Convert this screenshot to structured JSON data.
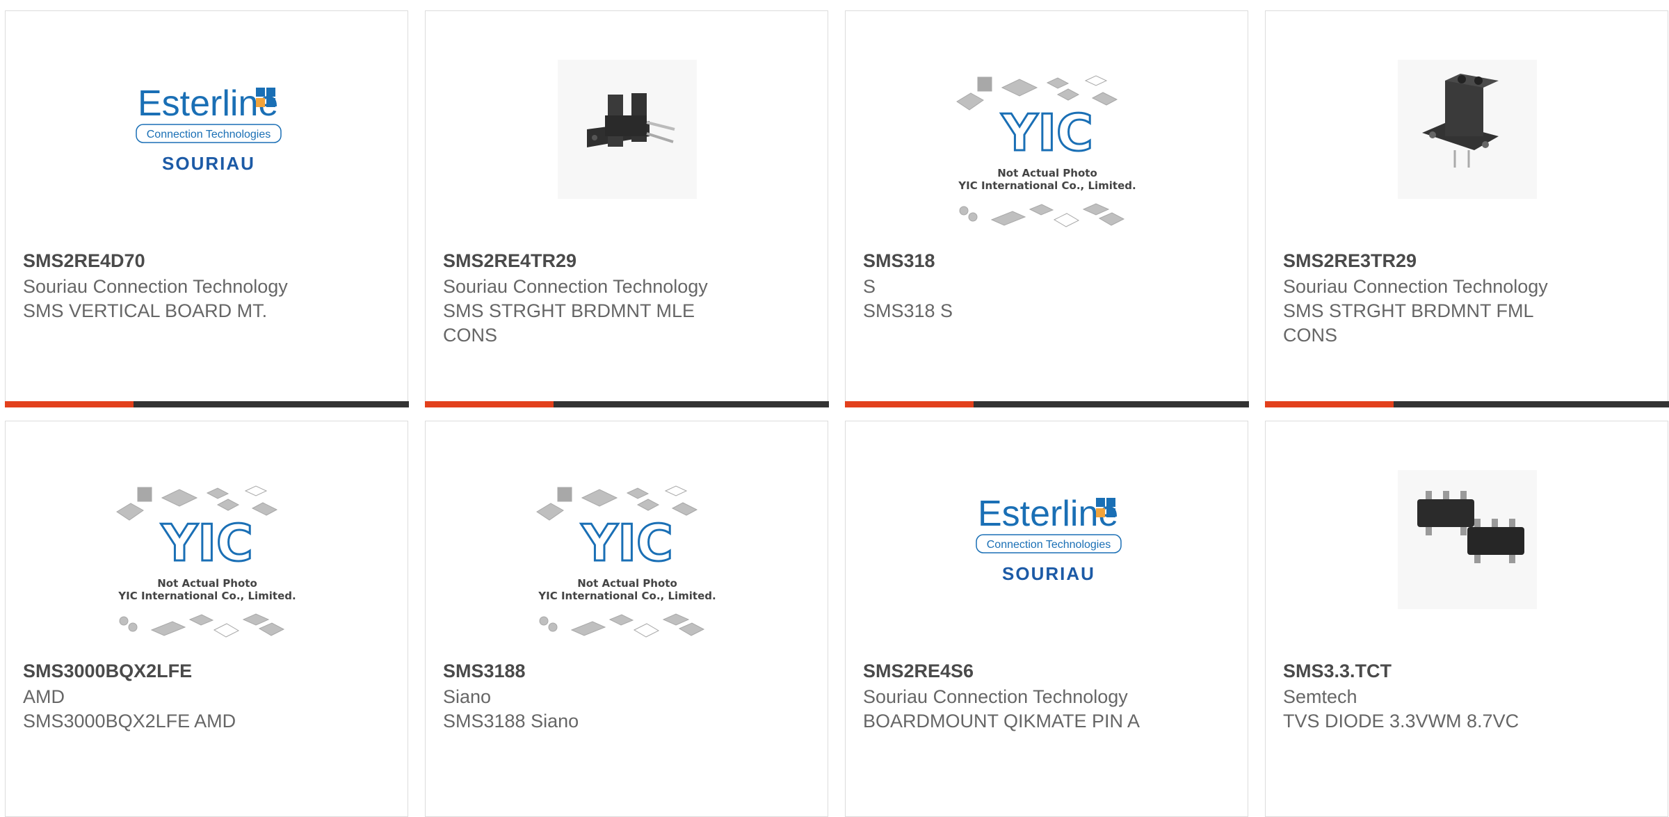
{
  "cards": [
    {
      "part": "SMS2RE4D70",
      "manufacturer": "Souriau Connection Technology",
      "description": "SMS VERTICAL BOARD MT.",
      "image": "esterline-souriau-logo",
      "logo_text": {
        "brand": "Esterline",
        "sub": "Connection Technologies",
        "name": "SOURIAU"
      }
    },
    {
      "part": "SMS2RE4TR29",
      "manufacturer": "Souriau Connection Technology",
      "description": "SMS STRGHT BRDMNT MLE CONS",
      "image": "connector-photo-male"
    },
    {
      "part": "SMS318",
      "manufacturer": "S",
      "description": "SMS318 S",
      "image": "yic-placeholder",
      "placeholder_text": {
        "logo": "YIC",
        "line1": "Not Actual Photo",
        "line2": "YIC International Co., Limited."
      }
    },
    {
      "part": "SMS2RE3TR29",
      "manufacturer": "Souriau Connection Technology",
      "description": "SMS STRGHT BRDMNT FML CONS",
      "image": "connector-photo-female"
    },
    {
      "part": "SMS3000BQX2LFE",
      "manufacturer": "AMD",
      "description": "SMS3000BQX2LFE AMD",
      "image": "yic-placeholder",
      "placeholder_text": {
        "logo": "YIC",
        "line1": "Not Actual Photo",
        "line2": "YIC International Co., Limited."
      }
    },
    {
      "part": "SMS3188",
      "manufacturer": "Siano",
      "description": "SMS3188 Siano",
      "image": "yic-placeholder",
      "placeholder_text": {
        "logo": "YIC",
        "line1": "Not Actual Photo",
        "line2": "YIC International Co., Limited."
      }
    },
    {
      "part": "SMS2RE4S6",
      "manufacturer": "Souriau Connection Technology",
      "description": "BOARDMOUNT QIKMATE PIN A",
      "image": "esterline-souriau-logo",
      "logo_text": {
        "brand": "Esterline",
        "sub": "Connection Technologies",
        "name": "SOURIAU"
      }
    },
    {
      "part": "SMS3.3.TCT",
      "manufacturer": "Semtech",
      "description": "TVS DIODE 3.3VWM 8.7VC",
      "image": "diode-sot-photo"
    }
  ],
  "colors": {
    "accent": "#e2401c",
    "bar": "#333333",
    "esterline_blue": "#1a6fb5",
    "souriau_blue": "#1c5aa6"
  }
}
